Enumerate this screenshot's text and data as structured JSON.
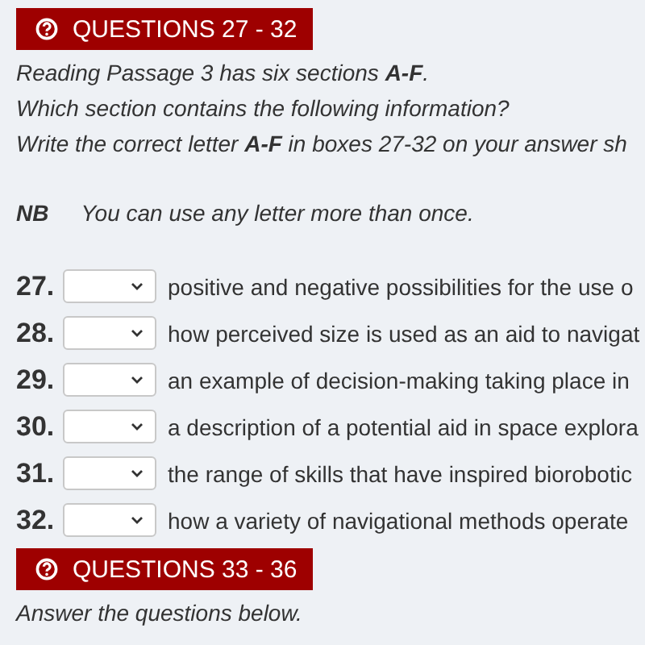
{
  "sections": [
    {
      "heading": "QUESTIONS 27 - 32",
      "instructions": [
        "Reading Passage 3 has six sections **A-F**.",
        "Which section contains the following information?",
        "Write the correct letter **A-F** in boxes 27-32 on your answer sh"
      ],
      "note": {
        "label": "NB",
        "text": "You can use any letter more than once."
      },
      "questions": [
        {
          "number": "27.",
          "text": "positive and negative possibilities for the use o"
        },
        {
          "number": "28.",
          "text": "how perceived size is used as an aid to navigat"
        },
        {
          "number": "29.",
          "text": "an example of decision-making taking place in"
        },
        {
          "number": "30.",
          "text": "a description of a potential aid in space explora"
        },
        {
          "number": "31.",
          "text": "the range of skills that have inspired biorobotic"
        },
        {
          "number": "32.",
          "text": "how a variety of navigational methods operate"
        }
      ]
    },
    {
      "heading": "QUESTIONS 33 - 36",
      "instructions": [
        "Answer the questions below."
      ]
    }
  ]
}
